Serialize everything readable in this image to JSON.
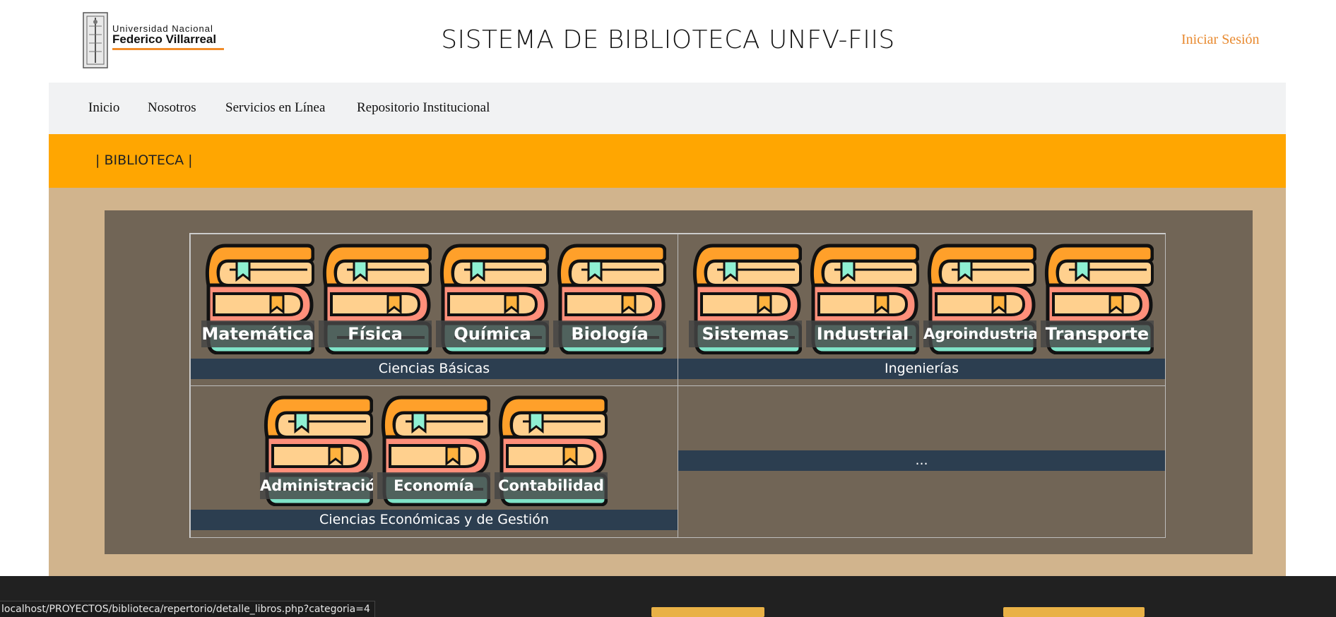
{
  "header": {
    "logo_line1": "Universidad Nacional",
    "logo_line2": "Federico Villarreal",
    "title": "SISTEMA DE BIBLIOTECA UNFV-FIIS",
    "login_label": "Iniciar Sesión"
  },
  "nav": {
    "items": [
      "Inicio",
      "Nosotros",
      "Servicios en Línea",
      "Repositorio Institucional"
    ]
  },
  "band": {
    "label": "| BIBLIOTECA |"
  },
  "categories": [
    {
      "title": "Ciencias Básicas",
      "books": [
        "Matemática",
        "Física",
        "Química",
        "Biología"
      ]
    },
    {
      "title": "Ingenierías",
      "books": [
        "Sistemas",
        "Industrial",
        "Agroindustrial",
        "Transporte"
      ]
    },
    {
      "title": "Ciencias Económicas y de Gestión",
      "books": [
        "Administración",
        "Economía",
        "Contabilidad"
      ]
    },
    {
      "title": "...",
      "books": []
    }
  ],
  "status_bar": {
    "url": "localhost/PROYECTOS/biblioteca/repertorio/detalle_libros.php?categoria=4"
  },
  "colors": {
    "accent": "#ffa601",
    "link": "#e88a30",
    "category_bar": "#2c3e50",
    "panel": "#716556",
    "tan": "#d1b48d"
  }
}
